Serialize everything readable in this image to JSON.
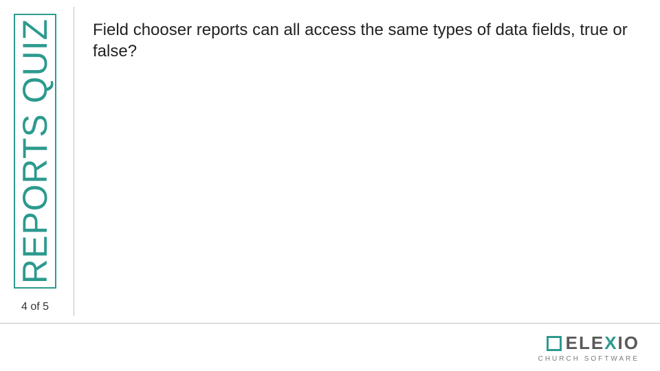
{
  "sidebar": {
    "title": "REPORTS QUIZ",
    "progress": "4 of 5"
  },
  "question": {
    "text": "Field chooser reports can all access the same types of data fields, true or false?"
  },
  "logo": {
    "pre": "ELE",
    "highlight": "X",
    "post": "IO",
    "subtitle": "CHURCH SOFTWARE"
  }
}
